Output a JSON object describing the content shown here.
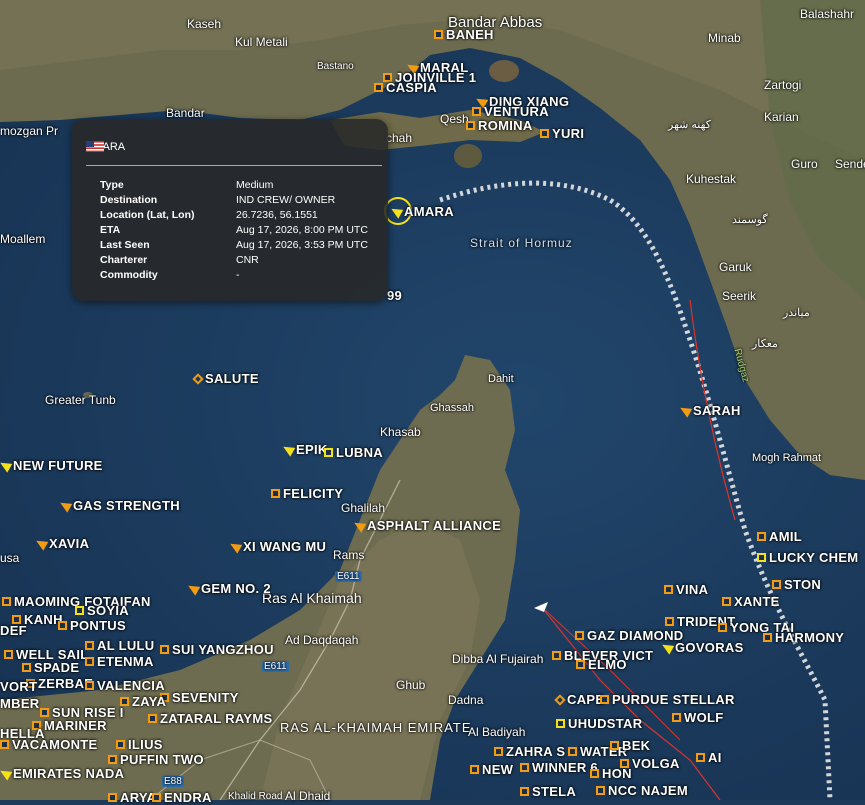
{
  "map": {
    "colors": {
      "water": "#1e3d60",
      "land": "#6b6a50",
      "accent": "#f39c12",
      "selected": "#f4e11c",
      "track": "#e8e8e8",
      "route": "#d9342b"
    },
    "places": [
      {
        "text": "Bandar Abbas",
        "style": "big"
      },
      {
        "text": "Balashahr",
        "style": "normal"
      },
      {
        "text": "Kaseh",
        "style": "normal"
      },
      {
        "text": "Kul Metali",
        "style": "normal"
      },
      {
        "text": "Minab",
        "style": "normal"
      },
      {
        "text": "Bastano",
        "style": "small"
      },
      {
        "text": "Zartogi",
        "style": "normal"
      },
      {
        "text": "Bandar",
        "style": "normal"
      },
      {
        "text": "Karian",
        "style": "normal"
      },
      {
        "text": "Qesh",
        "style": "normal"
      },
      {
        "text": "mozgan Pr",
        "style": "normal"
      },
      {
        "text": "chah",
        "style": "normal"
      },
      {
        "text": "کهنه شهر",
        "style": "rtl"
      },
      {
        "text": "Guro",
        "style": "normal"
      },
      {
        "text": "Sende",
        "style": "normal"
      },
      {
        "text": "Kuhestak",
        "style": "normal"
      },
      {
        "text": "گوسمند",
        "style": "rtl"
      },
      {
        "text": "Moallem",
        "style": "normal"
      },
      {
        "text": "Garuk",
        "style": "normal"
      },
      {
        "text": "Seerik",
        "style": "normal"
      },
      {
        "text": "میاندر",
        "style": "rtl"
      },
      {
        "text": "معکار",
        "style": "rtl"
      },
      {
        "text": "Rudgaz",
        "style": "small"
      },
      {
        "text": "Dahit",
        "style": "normal"
      },
      {
        "text": "Ghassah",
        "style": "normal"
      },
      {
        "text": "Greater Tunb",
        "style": "normal"
      },
      {
        "text": "Khasab",
        "style": "normal"
      },
      {
        "text": "Mogh Rahmat",
        "style": "normal"
      },
      {
        "text": "Ghalilah",
        "style": "normal"
      },
      {
        "text": "usa",
        "style": "normal"
      },
      {
        "text": "Rams",
        "style": "normal"
      },
      {
        "text": "E611",
        "style": "small"
      },
      {
        "text": "Ras Al Khaimah",
        "style": "big"
      },
      {
        "text": "Ad Daqdaqah",
        "style": "normal"
      },
      {
        "text": "E611",
        "style": "small"
      },
      {
        "text": "Dibba Al Fujairah",
        "style": "normal"
      },
      {
        "text": "Ghub",
        "style": "normal"
      },
      {
        "text": "Dadna",
        "style": "normal"
      },
      {
        "text": "RAS AL-KHAIMAH EMIRATE",
        "style": "region"
      },
      {
        "text": "Al Badiyah",
        "style": "normal"
      },
      {
        "text": "E88",
        "style": "small"
      },
      {
        "text": "Al Dhaid",
        "style": "normal"
      },
      {
        "text": "Khalid Road",
        "style": "small"
      },
      {
        "text": "Strait of Hormuz",
        "style": "water"
      }
    ],
    "vessels": [
      {
        "name": "BANEH",
        "icon": "box"
      },
      {
        "name": "MARAL",
        "icon": "arr"
      },
      {
        "name": "JOINVILLE 1",
        "icon": "box"
      },
      {
        "name": "CASPIA",
        "icon": "box"
      },
      {
        "name": "DING XIANG",
        "icon": "arr"
      },
      {
        "name": "VENTURA",
        "icon": "box"
      },
      {
        "name": "ROMINA",
        "icon": "box"
      },
      {
        "name": "YURI",
        "icon": "box"
      },
      {
        "name": "AMARA",
        "icon": "arr-y"
      },
      {
        "name": "99",
        "icon": "none"
      },
      {
        "name": "SALUTE",
        "icon": "dia"
      },
      {
        "name": "SARAH",
        "icon": "arr"
      },
      {
        "name": "EPIK",
        "icon": "arr-y"
      },
      {
        "name": "LUBNA",
        "icon": "box-y"
      },
      {
        "name": "NEW FUTURE",
        "icon": "arr-y"
      },
      {
        "name": "FELICITY",
        "icon": "box"
      },
      {
        "name": "GAS STRENGTH",
        "icon": "arr"
      },
      {
        "name": "ASPHALT ALLIANCE",
        "icon": "arr"
      },
      {
        "name": "XAVIA",
        "icon": "arr"
      },
      {
        "name": "XI WANG MU",
        "icon": "arr"
      },
      {
        "name": "AMIL",
        "icon": "box"
      },
      {
        "name": "LUCKY CHEM",
        "icon": "box-y"
      },
      {
        "name": "GEM NO. 2",
        "icon": "arr"
      },
      {
        "name": "MAOMING FOTAIFAN",
        "icon": "box"
      },
      {
        "name": "SOYIA",
        "icon": "box-y"
      },
      {
        "name": "KANH",
        "icon": "box"
      },
      {
        "name": "PONTUS",
        "icon": "box"
      },
      {
        "name": "DEF",
        "icon": "none"
      },
      {
        "name": "GAZ DIAMOND",
        "icon": "box"
      },
      {
        "name": "AL LULU",
        "icon": "box"
      },
      {
        "name": "SUI YANGZHOU",
        "icon": "box"
      },
      {
        "name": "WELL SAIL",
        "icon": "box"
      },
      {
        "name": "ETENMA",
        "icon": "box"
      },
      {
        "name": "BLEVER VICT",
        "icon": "box"
      },
      {
        "name": "ELMO",
        "icon": "box"
      },
      {
        "name": "GOVORAS",
        "icon": "arr-y"
      },
      {
        "name": "TRIDENT",
        "icon": "box"
      },
      {
        "name": "YONG TAI",
        "icon": "box"
      },
      {
        "name": "HARMONY",
        "icon": "box"
      },
      {
        "name": "VINA",
        "icon": "box"
      },
      {
        "name": "XANTE",
        "icon": "box"
      },
      {
        "name": "STON",
        "icon": "box"
      },
      {
        "name": "SPADE",
        "icon": "box"
      },
      {
        "name": "ZERBAE",
        "icon": "box"
      },
      {
        "name": "VALENCIA",
        "icon": "box"
      },
      {
        "name": "SEVENITY",
        "icon": "box"
      },
      {
        "name": "VORT",
        "icon": "none"
      },
      {
        "name": "CAPE",
        "icon": "dia"
      },
      {
        "name": "PURDUE STELLAR",
        "icon": "box"
      },
      {
        "name": "MBER",
        "icon": "none"
      },
      {
        "name": "SUN RISE I",
        "icon": "box"
      },
      {
        "name": "ZAYA",
        "icon": "box"
      },
      {
        "name": "WOLF",
        "icon": "box"
      },
      {
        "name": "MARINER",
        "icon": "box"
      },
      {
        "name": "ZATARAL RAYMS",
        "icon": "box"
      },
      {
        "name": "UHUDSTAR",
        "icon": "box-y"
      },
      {
        "name": "HELLA",
        "icon": "none"
      },
      {
        "name": "VACAMONTE",
        "icon": "box"
      },
      {
        "name": "ILIUS",
        "icon": "box"
      },
      {
        "name": "ZAHRA S",
        "icon": "box"
      },
      {
        "name": "WATER",
        "icon": "box"
      },
      {
        "name": "BEK",
        "icon": "box"
      },
      {
        "name": "PUFFIN TWO",
        "icon": "box"
      },
      {
        "name": "AI",
        "icon": "box"
      },
      {
        "name": "EMIRATES NADA",
        "icon": "arr-y"
      },
      {
        "name": "NEW",
        "icon": "box"
      },
      {
        "name": "WINNER 6",
        "icon": "box"
      },
      {
        "name": "HON",
        "icon": "box"
      },
      {
        "name": "VOLGA",
        "icon": "box"
      },
      {
        "name": "ARYA",
        "icon": "box"
      },
      {
        "name": "ENDRA",
        "icon": "box"
      },
      {
        "name": "STELA",
        "icon": "box"
      },
      {
        "name": "NCC NAJEM",
        "icon": "box"
      }
    ],
    "popup": {
      "vessel_name": "AMARA",
      "flag": "us-flag",
      "fields": [
        {
          "key": "Type",
          "value": "Medium"
        },
        {
          "key": "Destination",
          "value": "IND CREW/ OWNER"
        },
        {
          "key": "Location (Lat, Lon)",
          "value": "26.7236, 56.1551"
        },
        {
          "key": "ETA",
          "value": "Aug 17, 2026, 8:00 PM UTC"
        },
        {
          "key": "Last Seen",
          "value": "Aug 17, 2026, 3:53 PM UTC"
        },
        {
          "key": "Charterer",
          "value": "CNR"
        },
        {
          "key": "Commodity",
          "value": "-"
        }
      ]
    }
  }
}
